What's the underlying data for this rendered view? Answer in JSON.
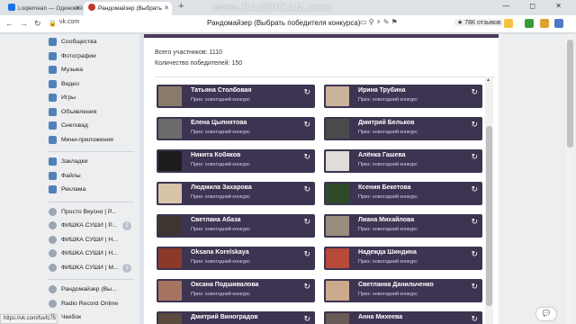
{
  "browser": {
    "tabs": [
      {
        "title": "Loqiemean — Одинокий"
      },
      {
        "title": "Рандомайзер (Выбрать"
      }
    ],
    "new_tab": "+",
    "watermark": "www.BANDICAM.com",
    "window_controls": "—  ◻  ✕",
    "url": "vk.com",
    "page_title": "Рандомайзер (Выбрать победителя конкурса)",
    "reviews_badge": "★ 78К отзывов",
    "status_url": "https://vk.com/fuvfc75"
  },
  "sidebar": {
    "items_a": [
      {
        "label": "Сообщества",
        "icon": "communities-icon"
      },
      {
        "label": "Фотографии",
        "icon": "photos-icon"
      },
      {
        "label": "Музыка",
        "icon": "music-icon"
      },
      {
        "label": "Видео",
        "icon": "video-icon"
      },
      {
        "label": "Игры",
        "icon": "games-icon"
      },
      {
        "label": "Объявления",
        "icon": "ads-icon"
      },
      {
        "label": "Снеговад",
        "icon": "snowflake-icon"
      },
      {
        "label": "Мини-приложения",
        "icon": "apps-icon"
      }
    ],
    "items_b": [
      {
        "label": "Закладки",
        "icon": "bookmarks-icon"
      },
      {
        "label": "Файлы",
        "icon": "files-icon"
      },
      {
        "label": "Реклама",
        "icon": "advertising-icon"
      }
    ],
    "items_c": [
      {
        "label": "Просто Вкусно | Р...",
        "badge": ""
      },
      {
        "label": "ФИШКА СУШИ | Р...",
        "badge": "2"
      },
      {
        "label": "ФИШКА СУШИ | Н...",
        "badge": ""
      },
      {
        "label": "ФИШКА СУШИ | Н...",
        "badge": ""
      },
      {
        "label": "ФИШКА СУШИ | М...",
        "badge": "1"
      }
    ],
    "items_d": [
      {
        "label": "Рандомайзер (Вы..."
      },
      {
        "label": "Radio Record Online"
      },
      {
        "label": "Чекбок"
      }
    ]
  },
  "main": {
    "total_participants": "Всего участников: 1110",
    "winners_count": "Количество победителей: 150",
    "prize_text": "Приз: новогодний конкурс",
    "winners": [
      {
        "name": "Татьяна Столбовая",
        "avatar_color": "#8a7a6a"
      },
      {
        "name": "Ирина Трубина",
        "avatar_color": "#c9b39b"
      },
      {
        "name": "Елена Цыпнятова",
        "avatar_color": "#6b6b6b"
      },
      {
        "name": "Дмитрий Бельков",
        "avatar_color": "#4a4a4a"
      },
      {
        "name": "Никита Кобяков",
        "avatar_color": "#1c1c1c"
      },
      {
        "name": "Алёнка Гашева",
        "avatar_color": "#e0dcd8"
      },
      {
        "name": "Людмила Захарова",
        "avatar_color": "#d8c4a8"
      },
      {
        "name": "Ксения Бекетова",
        "avatar_color": "#2e4a2a"
      },
      {
        "name": "Светлана Абаза",
        "avatar_color": "#3e3530"
      },
      {
        "name": "Лиана Михайлова",
        "avatar_color": "#9a8d80"
      },
      {
        "name": "Oksana Korelskaya",
        "avatar_color": "#8b3a2a"
      },
      {
        "name": "Надежда Шиндина",
        "avatar_color": "#b84a3a"
      },
      {
        "name": "Оксана Подшивалова",
        "avatar_color": "#a57460"
      },
      {
        "name": "Светланка Данильченко",
        "avatar_color": "#caa98c"
      },
      {
        "name": "Дмитрий Виноградов",
        "avatar_color": "#5a4a40"
      },
      {
        "name": "Анна Михеева",
        "avatar_color": "#6a5a58"
      }
    ]
  },
  "colors": {
    "card_bg": "#3d3452",
    "vk_blue": "#5181b8"
  }
}
